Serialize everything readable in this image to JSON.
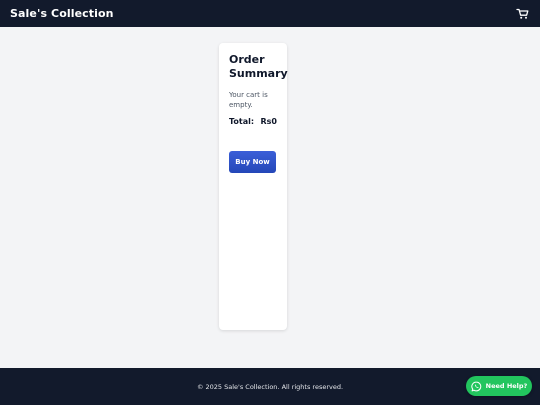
{
  "header": {
    "brand": "Sale's Collection",
    "cart_icon": "cart-icon"
  },
  "order_summary": {
    "title": "Order Summary",
    "empty_message": "Your cart is empty.",
    "total_label": "Total:",
    "total_value": "Rs0",
    "buy_label": "Buy Now"
  },
  "footer": {
    "copyright": "© 2025 Sale's Collection. All rights reserved."
  },
  "help": {
    "label": "Need Help?",
    "icon": "whatsapp-icon"
  },
  "colors": {
    "header_bg": "#121a2c",
    "page_bg": "#f3f4f6",
    "primary": "#2447b8",
    "help_green": "#22c55e"
  }
}
